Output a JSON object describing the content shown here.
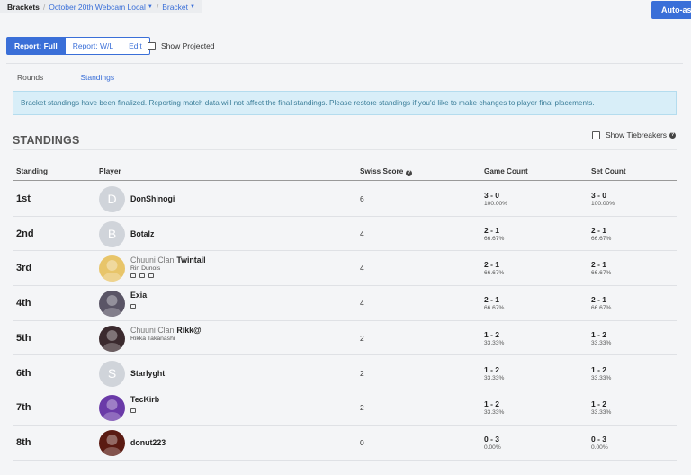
{
  "breadcrumb": {
    "root": "Brackets",
    "event": "October 20th Webcam Local",
    "bracket": "Bracket"
  },
  "auto_assign_label": "Auto-ass",
  "report_buttons": [
    "Report: Full",
    "Report: W/L",
    "Edit"
  ],
  "show_projected_label": "Show Projected",
  "tabs": [
    "Rounds",
    "Standings"
  ],
  "active_tab": "Standings",
  "alert_text": "Bracket standings have been finalized. Reporting match data will not affect the final standings. Please restore standings if you'd like to make changes to player final placements.",
  "heading": "STANDINGS",
  "tiebreakers_label": "Show Tiebreakers",
  "columns": [
    "Standing",
    "Player",
    "Swiss Score",
    "Game Count",
    "Set Count"
  ],
  "rows": [
    {
      "rank": "1st",
      "prefix": "",
      "name": "DonShinogi",
      "realname": "",
      "avatar": "D",
      "avatar_color": "#d0d4da",
      "socials": [],
      "swiss": "6",
      "game": "3 - 0",
      "game_pct": "100.00%",
      "set": "3 - 0",
      "set_pct": "100.00%"
    },
    {
      "rank": "2nd",
      "prefix": "",
      "name": "Botalz",
      "realname": "",
      "avatar": "B",
      "avatar_color": "#d0d4da",
      "socials": [],
      "swiss": "4",
      "game": "2 - 1",
      "game_pct": "66.67%",
      "set": "2 - 1",
      "set_pct": "66.67%"
    },
    {
      "rank": "3rd",
      "prefix": "Chuuni Clan",
      "name": "Twintail",
      "realname": "Rin Dunois",
      "avatar": "",
      "avatar_color": "#e8c56a",
      "socials": [
        "chat-icon",
        "twitter-icon",
        "discord-icon"
      ],
      "swiss": "4",
      "game": "2 - 1",
      "game_pct": "66.67%",
      "set": "2 - 1",
      "set_pct": "66.67%"
    },
    {
      "rank": "4th",
      "prefix": "",
      "name": "Exia",
      "realname": "",
      "avatar": "",
      "avatar_color": "#5a5566",
      "socials": [
        "discord-icon"
      ],
      "swiss": "4",
      "game": "2 - 1",
      "game_pct": "66.67%",
      "set": "2 - 1",
      "set_pct": "66.67%"
    },
    {
      "rank": "5th",
      "prefix": "Chuuni Clan",
      "name": "Rikk@",
      "realname": "Rikka Takanashi",
      "avatar": "",
      "avatar_color": "#3b2a2e",
      "socials": [],
      "swiss": "2",
      "game": "1 - 2",
      "game_pct": "33.33%",
      "set": "1 - 2",
      "set_pct": "33.33%"
    },
    {
      "rank": "6th",
      "prefix": "",
      "name": "Starlyght",
      "realname": "",
      "avatar": "S",
      "avatar_color": "#d0d4da",
      "socials": [],
      "swiss": "2",
      "game": "1 - 2",
      "game_pct": "33.33%",
      "set": "1 - 2",
      "set_pct": "33.33%"
    },
    {
      "rank": "7th",
      "prefix": "",
      "name": "TecKirb",
      "realname": "",
      "avatar": "",
      "avatar_color": "#6a3aa8",
      "socials": [
        "discord-icon"
      ],
      "swiss": "2",
      "game": "1 - 2",
      "game_pct": "33.33%",
      "set": "1 - 2",
      "set_pct": "33.33%"
    },
    {
      "rank": "8th",
      "prefix": "",
      "name": "donut223",
      "realname": "",
      "avatar": "",
      "avatar_color": "#5a1a12",
      "socials": [],
      "swiss": "0",
      "game": "0 - 3",
      "game_pct": "0.00%",
      "set": "0 - 3",
      "set_pct": "0.00%"
    }
  ],
  "colors": {
    "accent": "#3a6fd8",
    "alert_bg": "#d8eef8",
    "alert_text": "#3b7e99"
  }
}
